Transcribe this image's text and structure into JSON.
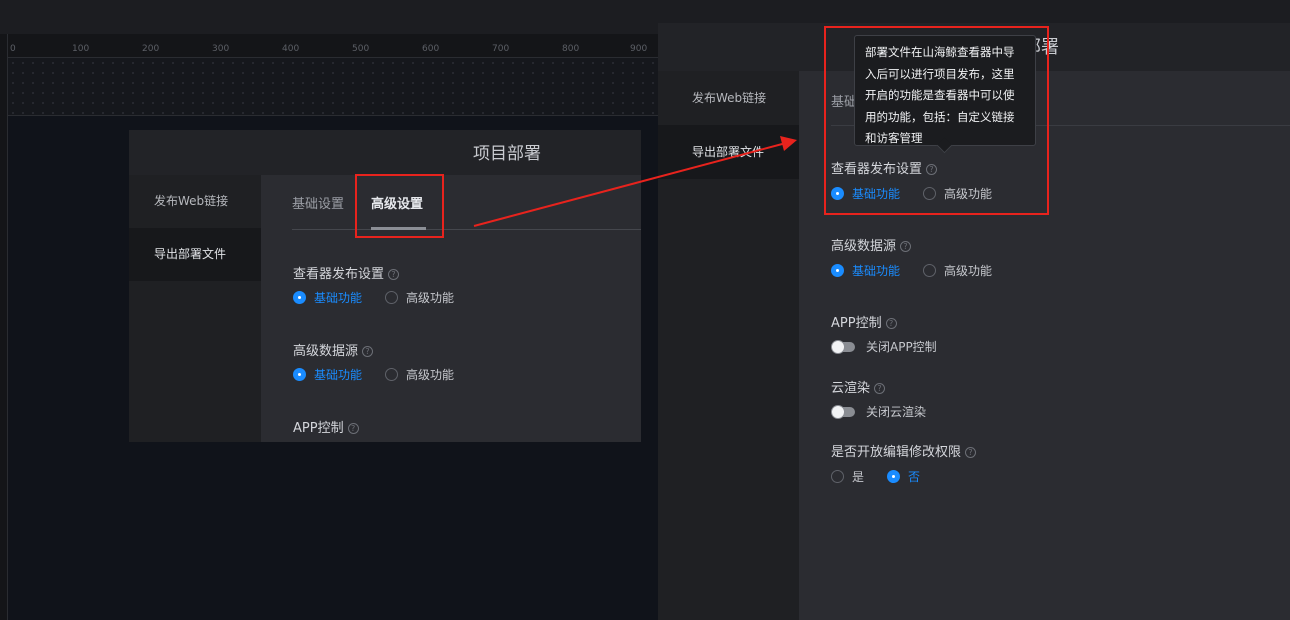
{
  "ruler": {
    "ticks": [
      "0",
      "100",
      "200",
      "300",
      "400",
      "500",
      "600",
      "700",
      "800",
      "900"
    ]
  },
  "small_modal": {
    "title": "项目部署",
    "side_items": [
      "发布Web链接",
      "导出部署文件"
    ],
    "tabs": [
      "基础设置",
      "高级设置"
    ],
    "sections": [
      {
        "label": "查看器发布设置",
        "options": [
          "基础功能",
          "高级功能"
        ],
        "selected": "基础功能"
      },
      {
        "label": "高级数据源",
        "options": [
          "基础功能",
          "高级功能"
        ],
        "selected": "基础功能"
      },
      {
        "label": "APP控制"
      }
    ]
  },
  "big_panel": {
    "title": "目部署",
    "side_items": [
      "发布Web链接",
      "导出部署文件"
    ],
    "tab_peek": "基础",
    "viewer_publish": {
      "label": "查看器发布设置",
      "options": [
        "基础功能",
        "高级功能"
      ],
      "selected": "基础功能"
    },
    "advanced_datasource": {
      "label": "高级数据源",
      "options": [
        "基础功能",
        "高级功能"
      ],
      "selected": "基础功能"
    },
    "app_control": {
      "label": "APP控制",
      "toggle_text": "关闭APP控制",
      "enabled": false
    },
    "cloud_render": {
      "label": "云渲染",
      "toggle_text": "关闭云渲染",
      "enabled": false
    },
    "edit_permission": {
      "label": "是否开放编辑修改权限",
      "options": [
        "是",
        "否"
      ],
      "selected": "否"
    }
  },
  "tooltip": {
    "text": "部署文件在山海鲸查看器中导入后可以进行项目发布，这里开启的功能是查看器中可以使用的功能，包括：自定义链接和访客管理"
  },
  "help_icon": "?",
  "colors": {
    "accent": "#1a8cff",
    "annotation": "#e8231d"
  }
}
